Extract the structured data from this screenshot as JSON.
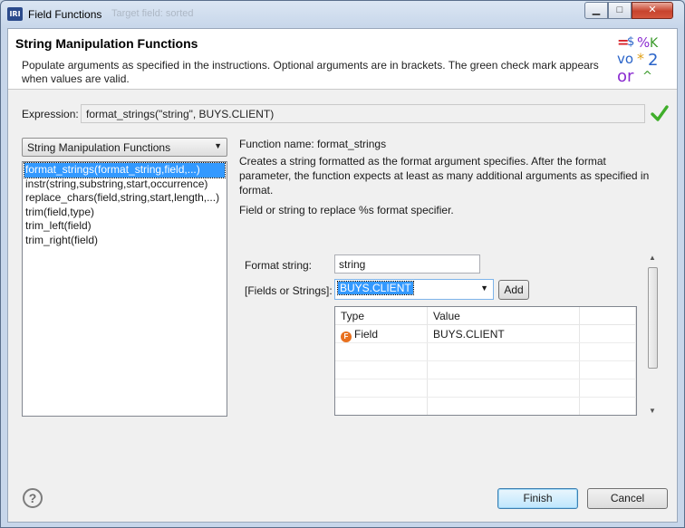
{
  "window": {
    "icon_text": "IRI",
    "title": "Field Functions",
    "ghost_title": "Target field: sorted"
  },
  "header": {
    "title": "String Manipulation Functions",
    "description": "Populate arguments as specified in the instructions. Optional arguments are in brackets. The green check mark appears when values are valid."
  },
  "expression": {
    "label": "Expression:",
    "value": "format_strings(\"string\", BUYS.CLIENT)"
  },
  "category_select": {
    "value": "String Manipulation Functions"
  },
  "functions": [
    "format_strings(format_string,field,...)",
    "instr(string,substring,start,occurrence)",
    "replace_chars(field,string,start,length,...)",
    "trim(field,type)",
    "trim_left(field)",
    "trim_right(field)"
  ],
  "function_info": {
    "name_line": "Function name:  format_strings",
    "description": "Creates a string formatted as the format argument specifies. After the format parameter, the function expects at least as many additional arguments as specified in format.",
    "argument_help": "Field or string to replace %s format specifier."
  },
  "form": {
    "format_label": "Format string:",
    "format_value": "string",
    "fields_label": "[Fields or Strings]:",
    "fields_value": "BUYS.CLIENT",
    "add_label": "Add"
  },
  "table": {
    "headers": [
      "Type",
      "Value",
      ""
    ],
    "rows": [
      {
        "type": "Field",
        "value": "BUYS.CLIENT"
      }
    ]
  },
  "buttons": {
    "help": "?",
    "finish": "Finish",
    "cancel": "Cancel"
  },
  "colors": {
    "selection": "#3399ff",
    "valid_check": "#3fae2a",
    "field_icon": "#e8701e"
  },
  "icons": [
    "app-logo-icon",
    "minimize-icon",
    "maximize-icon",
    "close-icon",
    "valid-check-icon",
    "chevron-down-icon",
    "field-type-icon",
    "help-icon"
  ]
}
